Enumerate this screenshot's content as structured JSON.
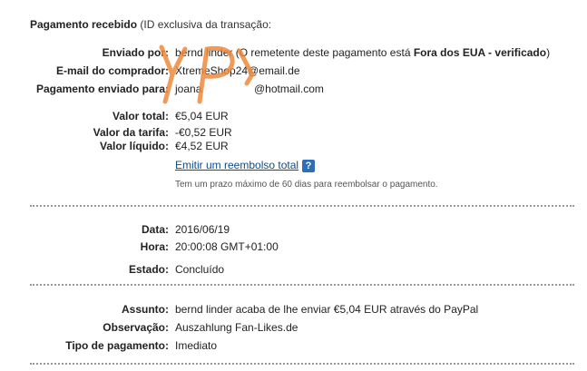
{
  "header": {
    "title_bold": "Pagamento recebido",
    "title_rest": " (ID exclusiva da transação:"
  },
  "sender": {
    "label": "Enviado por:",
    "name": "bernd linder",
    "note_pre": " (O remetente deste pagamento está ",
    "note_bold": "Fora dos EUA - verificado",
    "note_post": ")"
  },
  "buyer_email": {
    "label": "E-mail do comprador:",
    "value": "XtremeShop24@email.de"
  },
  "sent_to": {
    "label": "Pagamento enviado para:",
    "name": "joana",
    "domain": "@hotmail.com"
  },
  "amounts": {
    "total": {
      "label": "Valor total:",
      "value": "€5,04 EUR"
    },
    "fee": {
      "label": "Valor da tarifa:",
      "value": "-€0,52 EUR"
    },
    "net": {
      "label": "Valor líquido:",
      "value": "€4,52 EUR"
    }
  },
  "refund": {
    "link": "Emitir um reembolso total",
    "help_icon": "?",
    "note": "Tem um prazo máximo de 60 dias para reembolsar o pagamento."
  },
  "datetime": {
    "date": {
      "label": "Data:",
      "value": "2016/06/19"
    },
    "time": {
      "label": "Hora:",
      "value": "20:00:08 GMT+01:00"
    },
    "status": {
      "label": "Estado:",
      "value": "Concluído"
    }
  },
  "details": {
    "subject": {
      "label": "Assunto:",
      "value": "bernd linder acaba de lhe enviar €5,04 EUR através do PayPal"
    },
    "note": {
      "label": "Observação:",
      "value": "Auszahlung Fan-Likes.de"
    },
    "payment_type": {
      "label": "Tipo de pagamento:",
      "value": "Imediato"
    }
  },
  "colors": {
    "link": "#0c4c8a",
    "stamp": "#f08a3c",
    "help_icon_bg": "#2f6db5"
  },
  "icons": {
    "help": "question-mark-icon",
    "stamp": "handwritten-stamp"
  }
}
